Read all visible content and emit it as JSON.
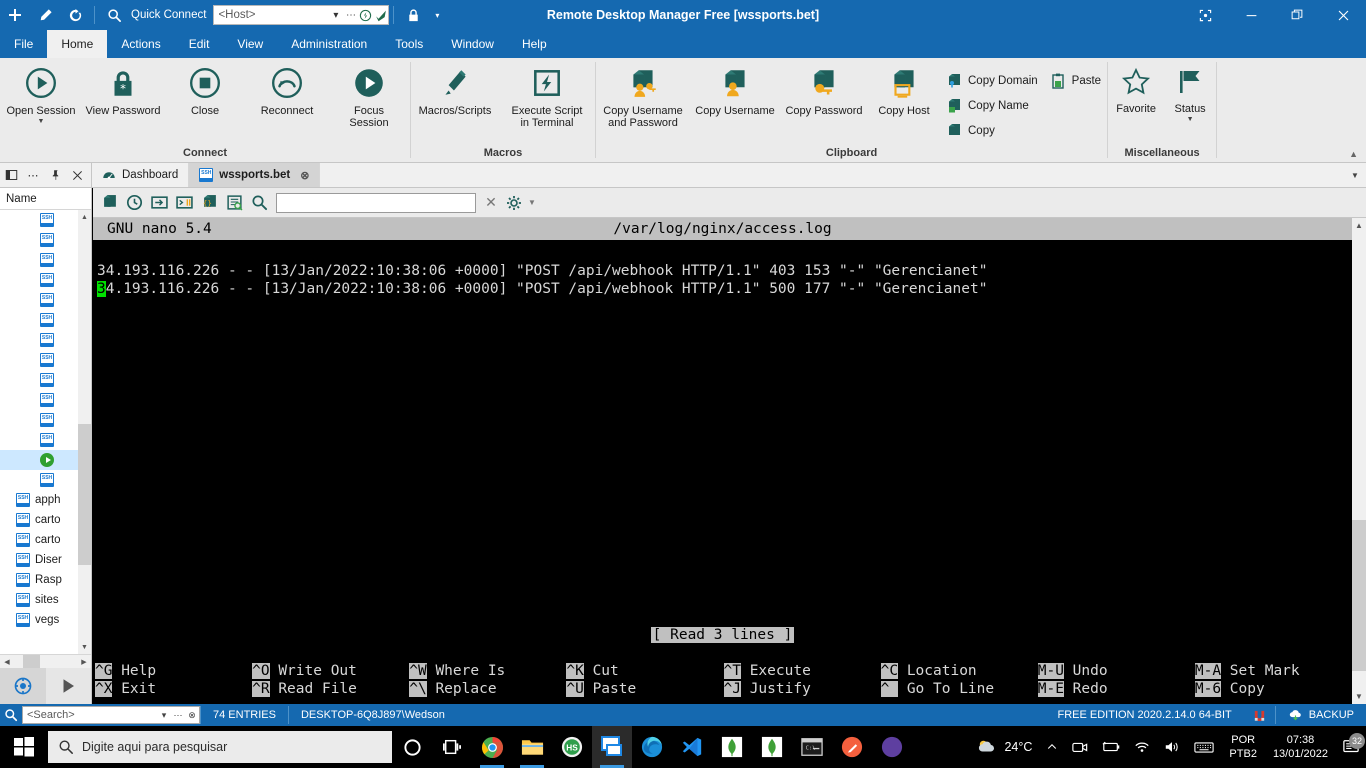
{
  "titlebar": {
    "window_title": "Remote Desktop Manager Free [wssports.bet]",
    "quick_connect_label": "Quick Connect",
    "host_placeholder": "<Host>",
    "buttons": [
      {
        "name": "new-entry-button",
        "glyph": "+"
      },
      {
        "name": "edit-entry-button",
        "glyph": "pencil"
      },
      {
        "name": "refresh-button",
        "glyph": "refresh"
      },
      {
        "name": "search-button",
        "glyph": "search"
      }
    ],
    "lock_icon": "lock-icon",
    "window_controls": [
      "restore-down-icon",
      "minimize-icon",
      "maximize-icon",
      "close-icon"
    ]
  },
  "menubar": {
    "items": [
      {
        "label": "File",
        "active": false
      },
      {
        "label": "Home",
        "active": true
      },
      {
        "label": "Actions",
        "active": false
      },
      {
        "label": "Edit",
        "active": false
      },
      {
        "label": "View",
        "active": false
      },
      {
        "label": "Administration",
        "active": false
      },
      {
        "label": "Tools",
        "active": false
      },
      {
        "label": "Window",
        "active": false
      },
      {
        "label": "Help",
        "active": false
      }
    ]
  },
  "ribbon": {
    "groups": [
      {
        "title": "Connect",
        "big_buttons": [
          {
            "label": "Open Session",
            "icon": "play-circle-icon",
            "has_caret": true
          },
          {
            "label": "View Password",
            "icon": "lock-asterisk-icon",
            "has_caret": false
          },
          {
            "label": "Close",
            "icon": "stop-circle-icon",
            "has_caret": false
          },
          {
            "label": "Reconnect",
            "icon": "undo-circle-icon",
            "has_caret": false
          },
          {
            "label": "Focus\nSession",
            "icon": "play-filled-circle-icon",
            "has_caret": false
          }
        ],
        "small_buttons": []
      },
      {
        "title": "Macros",
        "big_buttons": [
          {
            "label": "Macros/Scripts",
            "icon": "macro-script-icon",
            "has_caret": false
          },
          {
            "label": "Execute Script\nin Terminal",
            "icon": "lightning-square-icon",
            "has_caret": false
          }
        ],
        "small_buttons": []
      },
      {
        "title": "Clipboard",
        "big_buttons": [
          {
            "label": "Copy Username\nand Password",
            "icon": "copy-user-key-icon",
            "has_caret": false
          },
          {
            "label": "Copy Username",
            "icon": "copy-user-icon",
            "has_caret": false
          },
          {
            "label": "Copy Password",
            "icon": "copy-key-icon",
            "has_caret": false
          },
          {
            "label": "Copy Host",
            "icon": "copy-host-icon",
            "has_caret": false
          }
        ],
        "small_buttons": [
          {
            "label": "Copy Domain",
            "icon": "copy-domain-icon"
          },
          {
            "label": "Copy Name",
            "icon": "copy-name-icon"
          },
          {
            "label": "Copy",
            "icon": "copy-icon"
          }
        ],
        "small_buttons_2": [
          {
            "label": "Paste",
            "icon": "paste-icon"
          }
        ]
      },
      {
        "title": "Miscellaneous",
        "big_buttons": [
          {
            "label": "Favorite",
            "icon": "star-icon",
            "has_caret": false
          },
          {
            "label": "Status",
            "icon": "flag-icon",
            "has_caret": true
          }
        ],
        "small_buttons": []
      }
    ],
    "collapse_icon": "chevron-up-icon"
  },
  "tabstrip": {
    "panel_controls": [
      "panel-layout-icon",
      "panel-more-icon",
      "panel-pin-icon",
      "panel-close-icon"
    ],
    "tabs": [
      {
        "label": "Dashboard",
        "icon": "dashboard-icon",
        "selected": false,
        "closable": false
      },
      {
        "label": "wssports.bet",
        "icon": "ssh-icon",
        "selected": true,
        "closable": true
      }
    ],
    "overflow_icon": "chevron-down-icon"
  },
  "sidebar": {
    "header": "Name",
    "rows": [
      {
        "label": "",
        "icon": "ssh-icon",
        "indent": 3,
        "selected": false
      },
      {
        "label": "",
        "icon": "ssh-icon",
        "indent": 3,
        "selected": false
      },
      {
        "label": "",
        "icon": "ssh-icon",
        "indent": 3,
        "selected": false
      },
      {
        "label": "",
        "icon": "ssh-icon",
        "indent": 3,
        "selected": false
      },
      {
        "label": "",
        "icon": "ssh-icon",
        "indent": 3,
        "selected": false
      },
      {
        "label": "",
        "icon": "ssh-icon",
        "indent": 3,
        "selected": false
      },
      {
        "label": "",
        "icon": "ssh-icon",
        "indent": 3,
        "selected": false
      },
      {
        "label": "",
        "icon": "ssh-icon",
        "indent": 3,
        "selected": false
      },
      {
        "label": "",
        "icon": "ssh-icon",
        "indent": 3,
        "selected": false
      },
      {
        "label": "",
        "icon": "ssh-icon",
        "indent": 3,
        "selected": false
      },
      {
        "label": "",
        "icon": "ssh-icon",
        "indent": 3,
        "selected": false
      },
      {
        "label": "",
        "icon": "ssh-icon",
        "indent": 3,
        "selected": false
      },
      {
        "label": "",
        "icon": "play-icon",
        "indent": 3,
        "selected": true
      },
      {
        "label": "",
        "icon": "ssh-icon",
        "indent": 3,
        "selected": false
      },
      {
        "label": "apph",
        "icon": "ssh-icon",
        "indent": 1,
        "selected": false
      },
      {
        "label": "carto",
        "icon": "ssh-icon",
        "indent": 1,
        "selected": false
      },
      {
        "label": "carto",
        "icon": "ssh-icon",
        "indent": 1,
        "selected": false
      },
      {
        "label": "Diser",
        "icon": "ssh-icon",
        "indent": 1,
        "selected": false
      },
      {
        "label": "Rasp",
        "icon": "ssh-icon",
        "indent": 1,
        "selected": false
      },
      {
        "label": "sites",
        "icon": "ssh-icon",
        "indent": 1,
        "selected": false
      },
      {
        "label": "vegs",
        "icon": "ssh-icon",
        "indent": 1,
        "selected": false
      }
    ],
    "footer_buttons": [
      "session-settings-icon",
      "run-icon"
    ]
  },
  "session_toolbar": {
    "buttons": [
      "copy-icon",
      "history-icon",
      "send-keys-icon",
      "terminal-icon",
      "copy-brackets-icon",
      "log-search-icon",
      "search-icon"
    ],
    "search_value": "",
    "clear_icon": "close-icon",
    "settings_icon": "gear-icon"
  },
  "terminal": {
    "nano_version": "GNU nano 5.4",
    "file_path": "/var/log/nginx/access.log",
    "lines": [
      {
        "cursor_at": -1,
        "text": "34.193.116.226 - - [13/Jan/2022:10:38:06 +0000] \"POST /api/webhook HTTP/1.1\" 403 153 \"-\" \"Gerencianet\""
      },
      {
        "cursor_at": 0,
        "text": "34.193.116.226 - - [13/Jan/2022:10:38:06 +0000] \"POST /api/webhook HTTP/1.1\" 500 177 \"-\" \"Gerencianet\""
      }
    ],
    "status_message": "[ Read 3 lines ]",
    "shortcuts": [
      [
        {
          "key": "^G",
          "label": "Help"
        },
        {
          "key": "^X",
          "label": "Exit"
        }
      ],
      [
        {
          "key": "^O",
          "label": "Write Out"
        },
        {
          "key": "^R",
          "label": "Read File"
        }
      ],
      [
        {
          "key": "^W",
          "label": "Where Is"
        },
        {
          "key": "^\\",
          "label": "Replace"
        }
      ],
      [
        {
          "key": "^K",
          "label": "Cut"
        },
        {
          "key": "^U",
          "label": "Paste"
        }
      ],
      [
        {
          "key": "^T",
          "label": "Execute"
        },
        {
          "key": "^J",
          "label": "Justify"
        }
      ],
      [
        {
          "key": "^C",
          "label": "Location"
        },
        {
          "key": "^ ",
          "label": "Go To Line"
        }
      ],
      [
        {
          "key": "M-U",
          "label": "Undo"
        },
        {
          "key": "M-E",
          "label": "Redo"
        }
      ],
      [
        {
          "key": "M-A",
          "label": "Set Mark"
        },
        {
          "key": "M-6",
          "label": "Copy"
        }
      ]
    ]
  },
  "statusbar": {
    "search_placeholder": "<Search>",
    "entries_count": "74 ENTRIES",
    "user": "DESKTOP-6Q8J897\\Wedson",
    "edition": "FREE EDITION 2020.2.14.0 64-BIT",
    "magnet_icon": "magnet-icon",
    "backup_label": "BACKUP",
    "backup_icon": "backup-icon"
  },
  "taskbar": {
    "start_icon": "windows-start-icon",
    "search_placeholder": "Digite aqui para pesquisar",
    "search_icon": "search-icon",
    "pinned": [
      {
        "name": "cortana-icon",
        "active": false,
        "running": false
      },
      {
        "name": "task-view-icon",
        "active": false,
        "running": false
      },
      {
        "name": "chrome-icon",
        "active": false,
        "running": true
      },
      {
        "name": "file-explorer-icon",
        "active": false,
        "running": true
      },
      {
        "name": "hubspot-icon",
        "active": false,
        "running": false
      },
      {
        "name": "remote-desktop-manager-icon",
        "active": true,
        "running": true
      },
      {
        "name": "edge-icon",
        "active": false,
        "running": false
      },
      {
        "name": "vscode-icon",
        "active": false,
        "running": false
      },
      {
        "name": "mongodb-compass-icon",
        "active": false,
        "running": false
      },
      {
        "name": "mongodb-icon",
        "active": false,
        "running": false
      },
      {
        "name": "terminal-icon",
        "active": false,
        "running": false
      },
      {
        "name": "postman-icon",
        "active": false,
        "running": false
      },
      {
        "name": "app-purple-icon",
        "active": false,
        "running": false
      }
    ],
    "tray": {
      "temperature": "24°C",
      "overflow_icon": "chevron-up-icon",
      "icons": [
        "camera-icon",
        "battery-icon",
        "wifi-icon",
        "volume-icon",
        "keyboard-icon"
      ],
      "language_line1": "POR",
      "language_line2": "PTB2",
      "time": "07:38",
      "date": "13/01/2022",
      "notification_count": "32"
    }
  },
  "colors": {
    "brand_blue": "#1569b0",
    "ribbon_bg": "#ebebeb",
    "terminal_bg": "#000000",
    "cursor_green": "#00e000",
    "nano_bar": "#c0c0c0",
    "selection_blue": "#cde8ff"
  }
}
